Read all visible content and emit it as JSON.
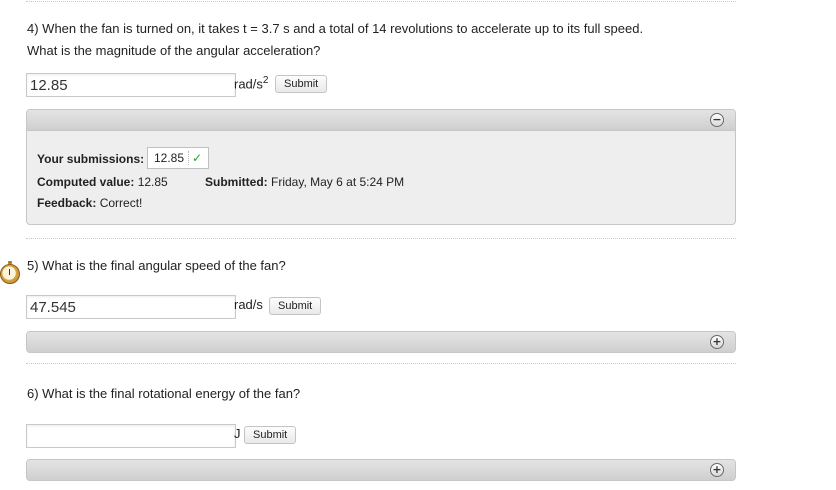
{
  "questions": [
    {
      "number_text": "4) When the fan is turned on, it takes t = 3.7 s and a total of 14 revolutions to accelerate up to its full speed.",
      "line2": "What is the magnitude of the angular acceleration?",
      "answer_value": "12.85",
      "unit": "rad/s",
      "unit_sup": "2",
      "submit_label": "Submit",
      "feedback_panel": {
        "expanded": true,
        "toggle_icon": "minus-circle-icon",
        "your_submissions_label": "Your submissions:",
        "submission_value": "12.85",
        "submission_status_icon": "checkmark-icon",
        "computed_value_label": "Computed value:",
        "computed_value": "12.85",
        "submitted_label": "Submitted:",
        "submitted_value": "Friday, May 6 at 5:24 PM",
        "feedback_label": "Feedback:",
        "feedback_value": "Correct!"
      }
    },
    {
      "number_text": "5) What is the final angular speed of the fan?",
      "answer_value": "47.545",
      "unit": "rad/s",
      "submit_label": "Submit",
      "feedback_panel": {
        "expanded": false,
        "toggle_icon": "plus-circle-icon"
      }
    },
    {
      "number_text": "6) What is the final rotational energy of the fan?",
      "answer_value": "",
      "unit": "J",
      "submit_label": "Submit",
      "feedback_panel": {
        "expanded": false,
        "toggle_icon": "plus-circle-icon"
      }
    }
  ],
  "icons": {
    "timer": "stopwatch-icon",
    "minus": "−",
    "plus": "+",
    "check": "✓"
  },
  "colors": {
    "check": "#2a9d2a",
    "panel_bg": "#eeeeee",
    "panel_bar": "#d6d6d6"
  }
}
